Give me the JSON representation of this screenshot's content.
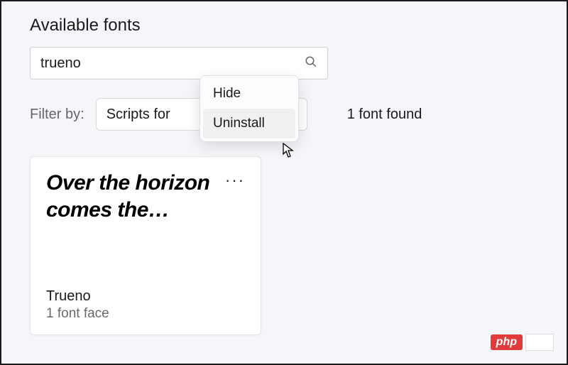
{
  "heading": "Available fonts",
  "search": {
    "value": "trueno"
  },
  "filter": {
    "label": "Filter by:",
    "selected": "Scripts for"
  },
  "found": "1 font found",
  "contextMenu": {
    "hide": "Hide",
    "uninstall": "Uninstall"
  },
  "card": {
    "preview": "Over the horizon comes the…",
    "name": "Trueno",
    "faces": "1 font face"
  },
  "badge": "php"
}
